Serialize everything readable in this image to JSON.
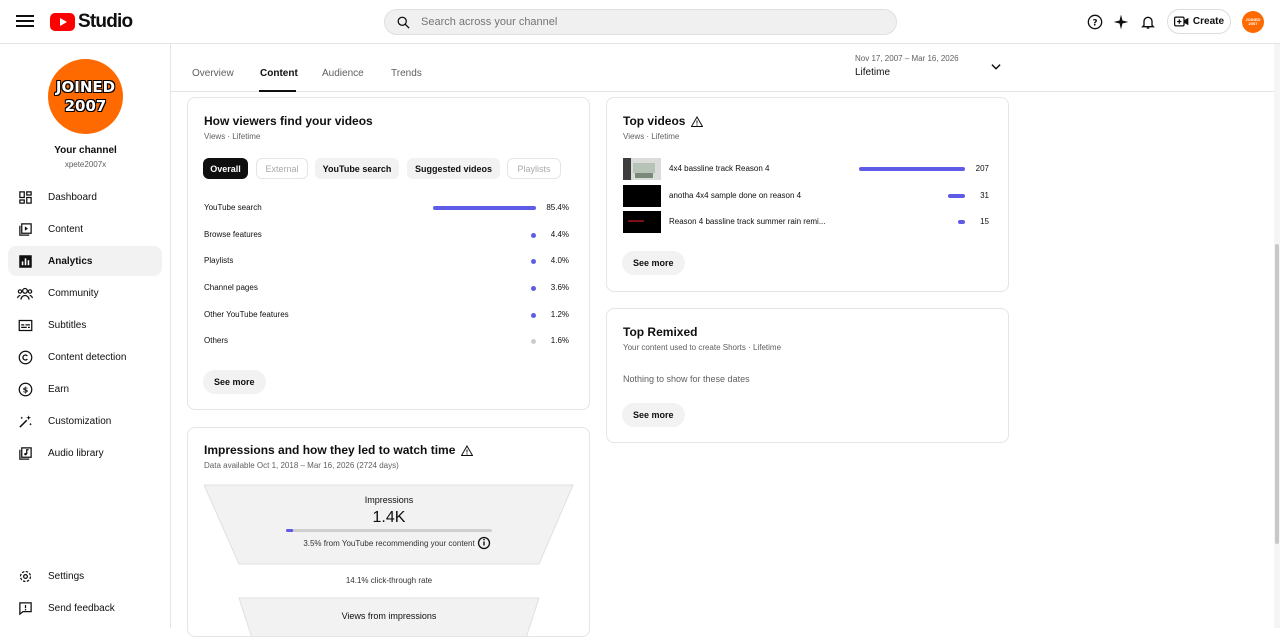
{
  "header": {
    "logo_text": "Studio",
    "search_placeholder": "Search across your channel",
    "create_label": "Create",
    "avatar_text": "JOINED 2007"
  },
  "channel": {
    "avatar_line1": "JOINED",
    "avatar_line2": "2007",
    "title": "Your channel",
    "handle": "xpete2007x"
  },
  "nav": {
    "items": [
      {
        "label": "Dashboard",
        "icon": "dashboard-icon"
      },
      {
        "label": "Content",
        "icon": "content-icon"
      },
      {
        "label": "Analytics",
        "icon": "analytics-icon"
      },
      {
        "label": "Community",
        "icon": "community-icon"
      },
      {
        "label": "Subtitles",
        "icon": "subtitles-icon"
      },
      {
        "label": "Content detection",
        "icon": "copyright-icon"
      },
      {
        "label": "Earn",
        "icon": "dollar-icon"
      },
      {
        "label": "Customization",
        "icon": "magic-wand-icon"
      },
      {
        "label": "Audio library",
        "icon": "audio-library-icon"
      }
    ],
    "settings_label": "Settings",
    "feedback_label": "Send feedback"
  },
  "tabs": [
    "Overview",
    "Content",
    "Audience",
    "Trends"
  ],
  "date_range": {
    "range": "Nov 17, 2007 – Mar 16, 2026",
    "label": "Lifetime"
  },
  "traffic": {
    "title": "How viewers find your videos",
    "subtitle": "Views · Lifetime",
    "chips": [
      "Overall",
      "External",
      "YouTube search",
      "Suggested videos",
      "Playlists"
    ],
    "rows": [
      {
        "name": "YouTube search",
        "value": "85.4%",
        "pct": 85.4
      },
      {
        "name": "Browse features",
        "value": "4.4%",
        "pct": 4.4
      },
      {
        "name": "Playlists",
        "value": "4.0%",
        "pct": 4.0
      },
      {
        "name": "Channel pages",
        "value": "3.6%",
        "pct": 3.6
      },
      {
        "name": "Other YouTube features",
        "value": "1.2%",
        "pct": 1.2
      },
      {
        "name": "Others",
        "value": "1.6%",
        "pct": 1.6
      }
    ],
    "see_more": "See more"
  },
  "impressions": {
    "title": "Impressions and how they led to watch time",
    "subtitle": "Data available Oct 1, 2018 – Mar 16, 2026 (2724 days)",
    "imp_label": "Impressions",
    "imp_value": "1.4K",
    "recommend_pct": 3.5,
    "recommend_text": "3.5% from YouTube recommending your content",
    "ctr_text": "14.1% click-through rate",
    "views_label": "Views from impressions"
  },
  "top_videos": {
    "title": "Top videos",
    "subtitle": "Views · Lifetime",
    "rows": [
      {
        "title": "4x4 bassline track Reason 4",
        "views": "207",
        "count": 207
      },
      {
        "title": "anotha 4x4 sample done on reason 4",
        "views": "31",
        "count": 31
      },
      {
        "title": "Reason 4 bassline track summer rain remi...",
        "views": "15",
        "count": 15
      }
    ],
    "see_more": "See more"
  },
  "top_remixed": {
    "title": "Top Remixed",
    "subtitle": "Your content used to create Shorts · Lifetime",
    "empty_text": "Nothing to show for these dates",
    "see_more": "See more"
  },
  "colors": {
    "accent": "#5e5ce6",
    "avatar_orange": "#ff6a00",
    "yt_red": "#ff0000"
  }
}
